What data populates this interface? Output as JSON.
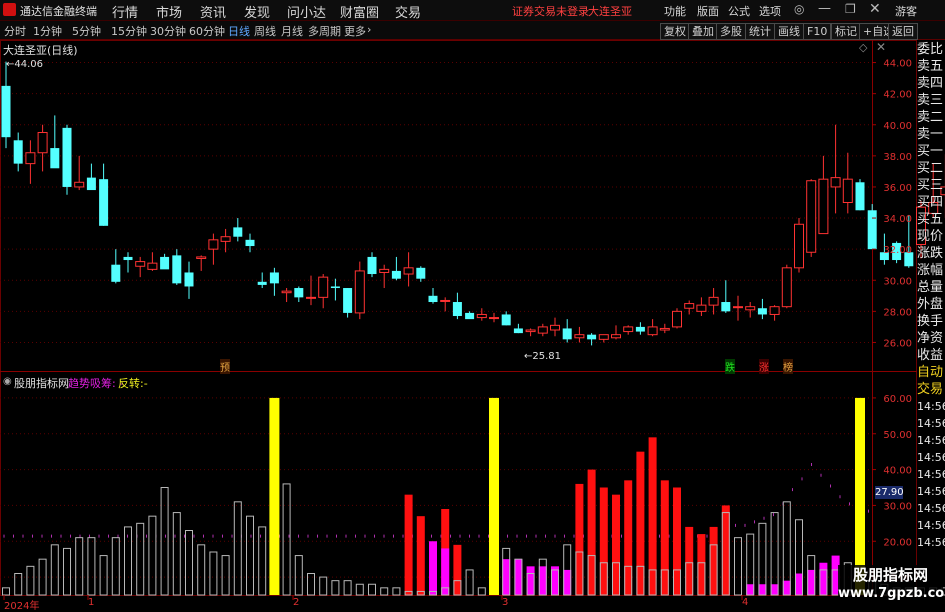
{
  "titlebar": {
    "app_name": "通达信金融终端",
    "menus": [
      "行情",
      "市场",
      "资讯",
      "发现",
      "问小达",
      "财富圈",
      "交易"
    ],
    "status": "证券交易未登录",
    "stock_name": "大连圣亚",
    "right_menus": [
      "功能",
      "版面",
      "公式",
      "选项"
    ],
    "guest": "游客"
  },
  "toolbar": {
    "periods": [
      "分时",
      "1分钟",
      "5分钟",
      "15分钟",
      "30分钟",
      "60分钟",
      "日线",
      "周线",
      "月线",
      "多周期",
      "更多"
    ],
    "active_period": "日线",
    "buttons": [
      "复权",
      "叠加",
      "多股",
      "统计",
      "画线",
      "F10",
      "标记",
      "+自选",
      "返回"
    ]
  },
  "main_chart": {
    "title": "大连圣亚(日线)",
    "high_label": "44.06",
    "low_label": "25.81",
    "markers": [
      "预",
      "跌",
      "涨",
      "榜"
    ]
  },
  "indicator": {
    "name": "股朋指标网",
    "label1": "趋势吸筹:",
    "label1_value": "-",
    "label2": "反转:",
    "label2_value": "-",
    "current_value": "27.90"
  },
  "axis": {
    "date_labels": [
      "2024年",
      "1",
      "2",
      "3",
      "4"
    ]
  },
  "right_panel": [
    "委比",
    "卖五",
    "卖四",
    "卖三",
    "卖二",
    "卖一",
    "买一",
    "买二",
    "买三",
    "买四",
    "买五",
    "现价",
    "涨跌",
    "涨幅",
    "总量",
    "外盘",
    "换手",
    "净资",
    "收益",
    "自动",
    "交易",
    "14:56",
    "14:56",
    "14:56",
    "14:56",
    "14:56",
    "14:56",
    "14:56",
    "14:56",
    "14:56"
  ],
  "watermark": {
    "line1": "股朋指标网",
    "line2": "www.7gpzb.com"
  },
  "chart_data": [
    {
      "type": "candlestick",
      "title": "大连圣亚(日线)",
      "ylim": [
        25,
        45
      ],
      "yticks": [
        26.0,
        28.0,
        30.0,
        32.0,
        34.0,
        36.0,
        38.0,
        40.0,
        42.0,
        44.0
      ],
      "candles": [
        [
          42.5,
          44.06,
          38.5,
          39.2
        ],
        [
          39.0,
          39.5,
          37.0,
          37.5
        ],
        [
          37.5,
          39.0,
          36.2,
          38.2
        ],
        [
          38.2,
          40.0,
          37.0,
          39.5
        ],
        [
          38.5,
          40.6,
          37.5,
          37.2
        ],
        [
          39.8,
          40.0,
          35.5,
          36.0
        ],
        [
          36.0,
          38.0,
          35.8,
          36.3
        ],
        [
          36.6,
          37.5,
          36.0,
          35.8
        ],
        [
          36.5,
          37.5,
          33.5,
          33.5
        ],
        [
          31.0,
          32.0,
          29.8,
          29.9
        ],
        [
          31.5,
          31.8,
          30.5,
          31.3
        ],
        [
          30.9,
          31.5,
          30.2,
          31.2
        ],
        [
          30.7,
          31.8,
          30.6,
          31.1
        ],
        [
          31.5,
          31.7,
          31.0,
          30.7
        ],
        [
          31.6,
          32.0,
          29.7,
          29.8
        ],
        [
          30.5,
          31.2,
          28.8,
          29.6
        ],
        [
          31.4,
          31.6,
          30.6,
          31.5
        ],
        [
          32.0,
          33.0,
          31.0,
          32.6
        ],
        [
          32.5,
          33.3,
          31.8,
          32.8
        ],
        [
          33.4,
          34.0,
          32.5,
          32.8
        ],
        [
          32.6,
          33.0,
          31.8,
          32.2
        ],
        [
          29.9,
          30.5,
          29.5,
          29.7
        ],
        [
          30.5,
          30.8,
          29.0,
          29.8
        ],
        [
          29.2,
          29.5,
          28.6,
          29.3
        ],
        [
          29.5,
          29.6,
          28.6,
          28.9
        ],
        [
          28.9,
          30.3,
          28.4,
          28.9
        ],
        [
          28.9,
          30.4,
          28.2,
          30.2
        ],
        [
          29.6,
          30.1,
          28.7,
          29.5
        ],
        [
          29.5,
          29.5,
          27.6,
          27.9
        ],
        [
          27.9,
          31.2,
          27.5,
          30.6
        ],
        [
          31.5,
          31.8,
          30.2,
          30.4
        ],
        [
          30.5,
          31.0,
          29.5,
          30.7
        ],
        [
          30.6,
          31.5,
          30.0,
          30.1
        ],
        [
          30.4,
          31.8,
          29.6,
          30.8
        ],
        [
          30.8,
          30.9,
          29.9,
          30.1
        ],
        [
          29.0,
          29.5,
          28.5,
          28.6
        ],
        [
          28.7,
          28.9,
          28.0,
          28.7
        ],
        [
          28.6,
          29.2,
          27.5,
          27.7
        ],
        [
          27.9,
          28.0,
          27.6,
          27.5
        ],
        [
          27.6,
          28.2,
          27.4,
          27.8
        ],
        [
          27.6,
          27.9,
          27.3,
          27.6
        ],
        [
          27.8,
          28.0,
          27.1,
          27.1
        ],
        [
          26.9,
          27.2,
          26.6,
          26.6
        ],
        [
          26.7,
          26.9,
          26.4,
          26.8
        ],
        [
          26.6,
          27.2,
          26.4,
          27.0
        ],
        [
          26.8,
          27.6,
          26.4,
          27.1
        ],
        [
          26.9,
          27.5,
          26.0,
          26.2
        ],
        [
          26.3,
          27.0,
          26.0,
          26.5
        ],
        [
          26.5,
          26.6,
          25.81,
          26.2
        ],
        [
          26.2,
          26.5,
          26.0,
          26.5
        ],
        [
          26.3,
          27.1,
          26.2,
          26.5
        ],
        [
          26.7,
          27.1,
          26.5,
          27.0
        ],
        [
          27.0,
          27.3,
          26.5,
          26.7
        ],
        [
          26.5,
          27.5,
          26.4,
          27.0
        ],
        [
          26.8,
          27.2,
          26.6,
          26.9
        ],
        [
          27.0,
          28.2,
          26.9,
          28.0
        ],
        [
          28.2,
          28.7,
          27.8,
          28.5
        ],
        [
          28.0,
          28.9,
          27.7,
          28.4
        ],
        [
          28.4,
          29.5,
          27.8,
          28.9
        ],
        [
          28.6,
          30.0,
          27.9,
          28.0
        ],
        [
          28.3,
          29.0,
          27.4,
          28.3
        ],
        [
          28.1,
          28.6,
          27.6,
          28.3
        ],
        [
          28.2,
          28.8,
          27.5,
          27.8
        ],
        [
          27.8,
          28.4,
          27.4,
          28.3
        ],
        [
          28.3,
          31.0,
          28.2,
          30.8
        ],
        [
          30.8,
          34.0,
          30.5,
          33.6
        ],
        [
          31.8,
          36.5,
          31.5,
          36.4
        ],
        [
          33.0,
          38.0,
          33.0,
          36.5
        ],
        [
          36.0,
          40.0,
          34.3,
          36.6
        ],
        [
          35.0,
          38.2,
          34.3,
          36.5
        ],
        [
          36.3,
          36.5,
          34.5,
          34.5
        ],
        [
          34.5,
          34.9,
          32.0,
          32.0
        ],
        [
          31.8,
          33.0,
          31.0,
          31.3
        ],
        [
          32.4,
          32.5,
          31.1,
          31.3
        ],
        [
          31.8,
          34.2,
          30.8,
          30.9
        ],
        [
          32.3,
          35.1,
          31.4,
          34.7
        ],
        [
          34.3,
          37.5,
          34.0,
          35.0
        ],
        [
          35.5,
          38.1,
          34.0,
          36.0
        ],
        [
          36.0,
          37.4,
          35.3,
          36.3
        ],
        [
          36.5,
          38.9,
          35.5,
          36.7
        ],
        [
          36.3,
          38.1,
          35.9,
          36.3
        ],
        [
          36.2,
          38.5,
          35.9,
          38.3
        ]
      ]
    },
    {
      "type": "bar",
      "title": "股朋指标网",
      "ylim": [
        5,
        65
      ],
      "yticks": [
        10.0,
        20.0,
        30.0,
        40.0,
        50.0,
        60.0
      ],
      "current": 27.9,
      "series": [
        {
          "name": "volume",
          "values": [
            7,
            11,
            13,
            15,
            19,
            18,
            21,
            21,
            16,
            21,
            24,
            25,
            27,
            35,
            28,
            23,
            19,
            17,
            16,
            31,
            27,
            24,
            33,
            36,
            16,
            11,
            10,
            9,
            9,
            8,
            8,
            7,
            7,
            6,
            6,
            6,
            7,
            9,
            12,
            7,
            9,
            18,
            15,
            11,
            15,
            12,
            19,
            17,
            16,
            14,
            14,
            13,
            13,
            12,
            12,
            12,
            14,
            14,
            19,
            28,
            21,
            22,
            25,
            28,
            31,
            26,
            16,
            12,
            12,
            14,
            9,
            9,
            8,
            7,
            7,
            7,
            7,
            7,
            7,
            6,
            6,
            6
          ]
        },
        {
          "name": "red",
          "values": [
            0,
            0,
            0,
            0,
            0,
            0,
            0,
            0,
            0,
            0,
            0,
            0,
            0,
            0,
            0,
            0,
            0,
            0,
            0,
            0,
            0,
            0,
            0,
            0,
            0,
            0,
            0,
            0,
            0,
            0,
            0,
            0,
            0,
            33,
            27,
            0,
            29,
            19,
            0,
            0,
            0,
            0,
            0,
            0,
            0,
            0,
            0,
            36,
            40,
            35,
            33,
            37,
            45,
            49,
            37,
            35,
            24,
            22,
            24,
            30,
            0,
            0,
            0,
            0,
            0,
            0,
            0,
            0,
            0,
            0,
            0,
            0,
            0,
            0,
            0,
            0,
            0,
            0,
            0,
            0,
            0,
            0
          ]
        },
        {
          "name": "magenta",
          "values": [
            0,
            0,
            0,
            0,
            0,
            0,
            0,
            0,
            0,
            0,
            0,
            0,
            0,
            0,
            0,
            0,
            0,
            0,
            0,
            0,
            0,
            0,
            0,
            0,
            0,
            0,
            0,
            0,
            0,
            0,
            0,
            0,
            0,
            0,
            0,
            20,
            18,
            0,
            0,
            0,
            16,
            15,
            15,
            13,
            13,
            13,
            12,
            0,
            0,
            0,
            0,
            0,
            0,
            0,
            0,
            0,
            0,
            0,
            0,
            0,
            0,
            8,
            8,
            8,
            9,
            11,
            12,
            14,
            16,
            0,
            0,
            0,
            0,
            0,
            0,
            0,
            0,
            0,
            0,
            0,
            0,
            0
          ]
        },
        {
          "name": "yellow",
          "values": [
            0,
            0,
            0,
            0,
            0,
            0,
            0,
            0,
            0,
            0,
            0,
            0,
            0,
            0,
            0,
            0,
            0,
            0,
            0,
            0,
            0,
            0,
            60,
            0,
            0,
            0,
            0,
            0,
            0,
            0,
            0,
            0,
            0,
            0,
            0,
            0,
            0,
            0,
            0,
            0,
            60,
            0,
            0,
            0,
            0,
            0,
            0,
            0,
            0,
            0,
            0,
            0,
            0,
            0,
            0,
            0,
            0,
            0,
            0,
            0,
            0,
            0,
            0,
            0,
            0,
            0,
            0,
            0,
            0,
            0,
            60,
            0,
            0,
            0,
            0,
            0,
            0,
            0,
            0,
            0,
            0,
            0
          ]
        },
        {
          "name": "purple",
          "values": [
            21,
            21,
            21,
            21,
            21,
            21,
            21,
            21,
            21,
            21,
            21,
            21,
            21,
            21,
            21,
            21,
            21,
            21,
            21,
            21,
            21,
            21,
            21,
            21,
            21,
            21,
            21,
            21,
            21,
            21,
            21,
            21,
            21,
            21,
            21,
            21,
            21,
            21,
            21,
            21,
            21,
            21,
            21,
            21,
            21,
            21,
            21,
            21,
            21,
            21,
            21,
            21,
            21,
            21,
            21,
            21,
            21,
            21,
            21,
            21,
            21,
            21,
            21,
            21,
            21,
            21,
            21,
            21,
            21,
            21,
            21,
            21,
            21,
            21,
            21,
            22,
            23,
            24,
            24,
            25,
            26,
            27,
            30,
            34,
            37,
            41,
            38,
            35,
            32,
            30,
            31,
            28,
            27
          ]
        }
      ]
    }
  ]
}
